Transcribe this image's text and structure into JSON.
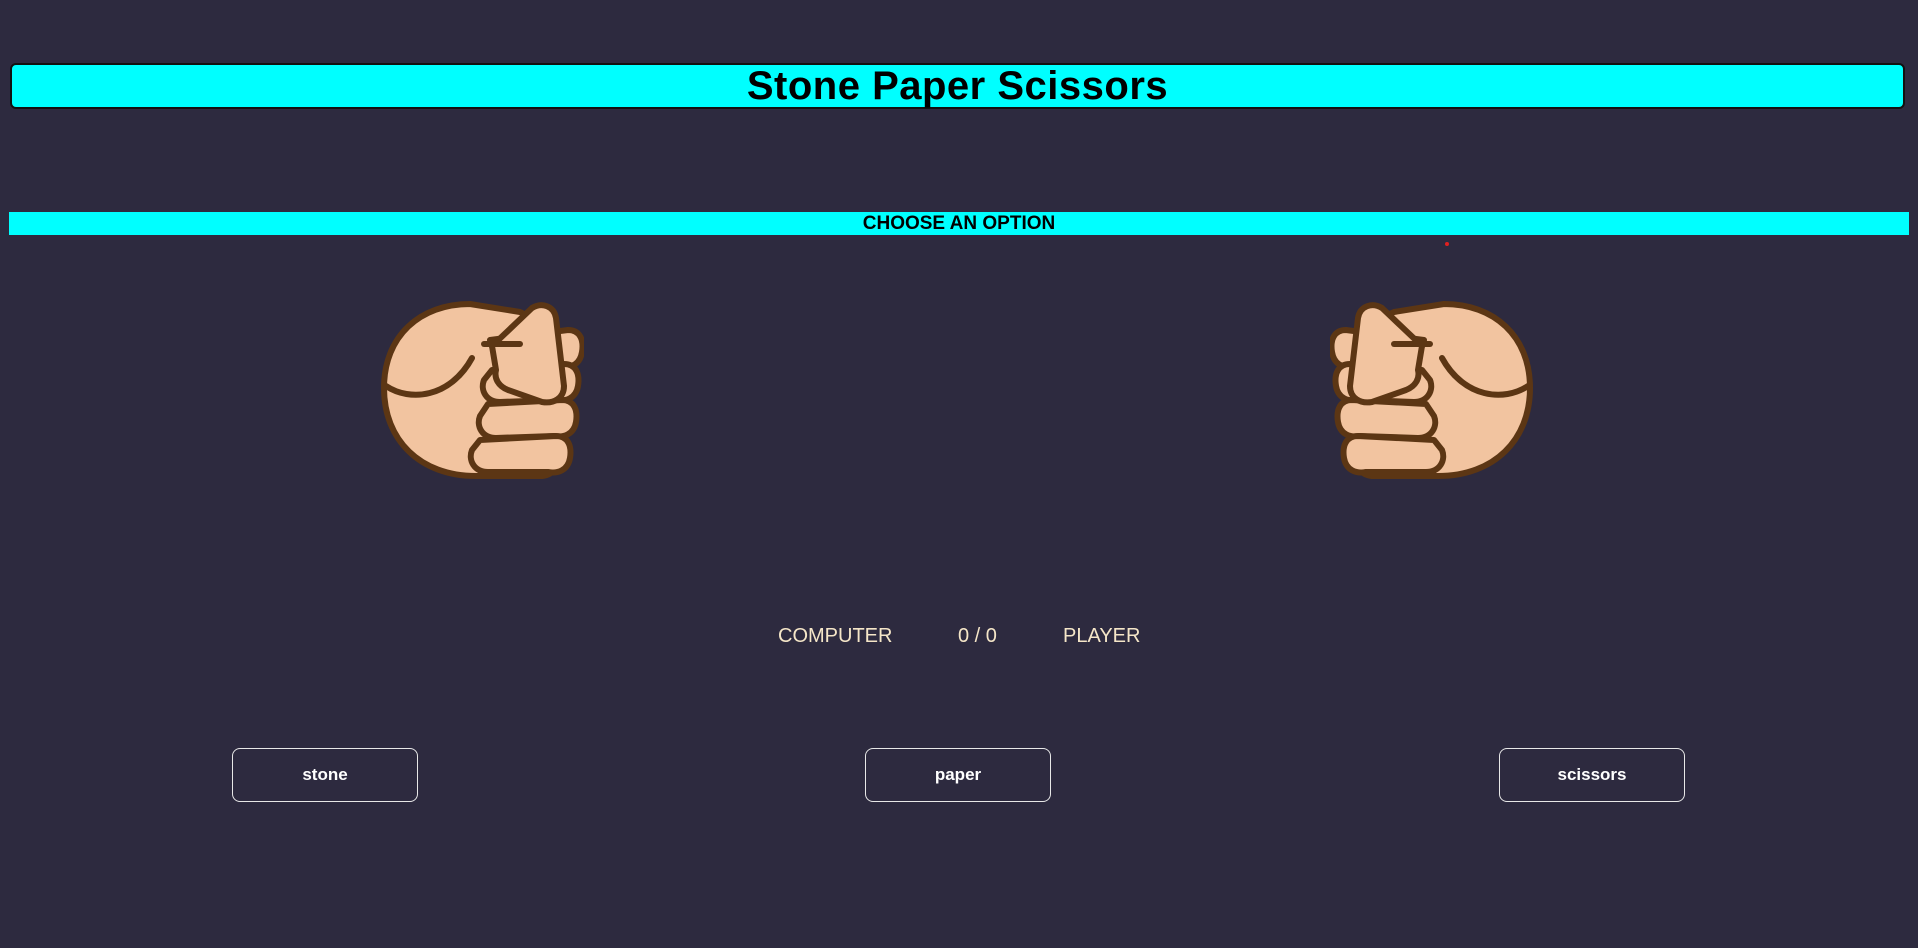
{
  "header": {
    "title": "Stone Paper Scissors"
  },
  "prompt": {
    "text": "CHOOSE AN OPTION"
  },
  "hands": {
    "computer_icon": "fist-icon",
    "player_icon": "fist-icon",
    "skin_color": "#f2c4a0",
    "outline_color": "#5c3614"
  },
  "scoreboard": {
    "computer_label": "COMPUTER",
    "score": "0 / 0",
    "player_label": "PLAYER"
  },
  "choices": {
    "stone_label": "stone",
    "paper_label": "paper",
    "scissors_label": "scissors"
  },
  "colors": {
    "background": "#2d2a3f",
    "accent": "#00ffff",
    "score_text": "#f5e6c8"
  }
}
